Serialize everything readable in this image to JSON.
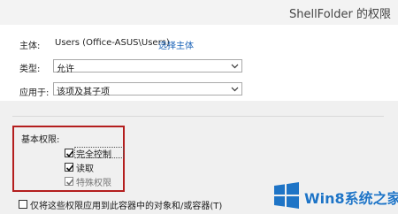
{
  "window": {
    "title": "ShellFolder 的权限"
  },
  "owner": {
    "label": "主体:",
    "value": "Users (Office-ASUS\\Users)",
    "link": "选择主体"
  },
  "type": {
    "label": "类型:",
    "value": "允许"
  },
  "applies_to": {
    "label": "应用于:",
    "value": "该项及其子项"
  },
  "basic_permissions": {
    "title": "基本权限:",
    "items": [
      {
        "label": "完全控制",
        "checked": true,
        "disabled": false
      },
      {
        "label": "读取",
        "checked": true,
        "disabled": false
      },
      {
        "label": "特殊权限",
        "checked": true,
        "disabled": true
      }
    ]
  },
  "apply_only": {
    "label": "仅将这些权限应用到此容器中的对象和/或容器(T)",
    "checked": false
  },
  "watermark": {
    "text": "Win8系统之家"
  }
}
